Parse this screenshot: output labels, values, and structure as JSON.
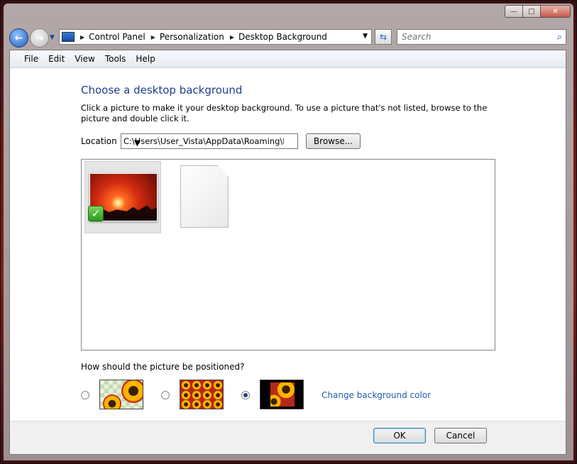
{
  "window": {
    "controls": {
      "minimize": "—",
      "maximize": "□",
      "close": "✕"
    }
  },
  "navigation": {
    "breadcrumbs": [
      "Control Panel",
      "Personalization",
      "Desktop Background"
    ],
    "search_placeholder": "Search"
  },
  "menu": [
    "File",
    "Edit",
    "View",
    "Tools",
    "Help"
  ],
  "main": {
    "heading": "Choose a desktop background",
    "instructions": "Click a picture to make it your desktop background. To use a picture that's not listed, browse to the picture and double click it.",
    "location_label": "Location",
    "location_value": "C:\\Users\\User_Vista\\AppData\\Roaming\\Mc",
    "browse_label": "Browse...",
    "pictures": [
      {
        "kind": "sunset photo",
        "selected": true
      },
      {
        "kind": "blank file",
        "selected": false
      }
    ],
    "position_question": "How should the picture be positioned?",
    "position_options": [
      {
        "name": "center",
        "selected": false
      },
      {
        "name": "tile",
        "selected": false
      },
      {
        "name": "fit",
        "selected": true
      }
    ],
    "change_color_link": "Change background color"
  },
  "footer": {
    "ok_label": "OK",
    "cancel_label": "Cancel"
  },
  "colors": {
    "heading": "#1f3e8c",
    "link": "#1f5fb0",
    "selection": "#2f9a1c"
  }
}
